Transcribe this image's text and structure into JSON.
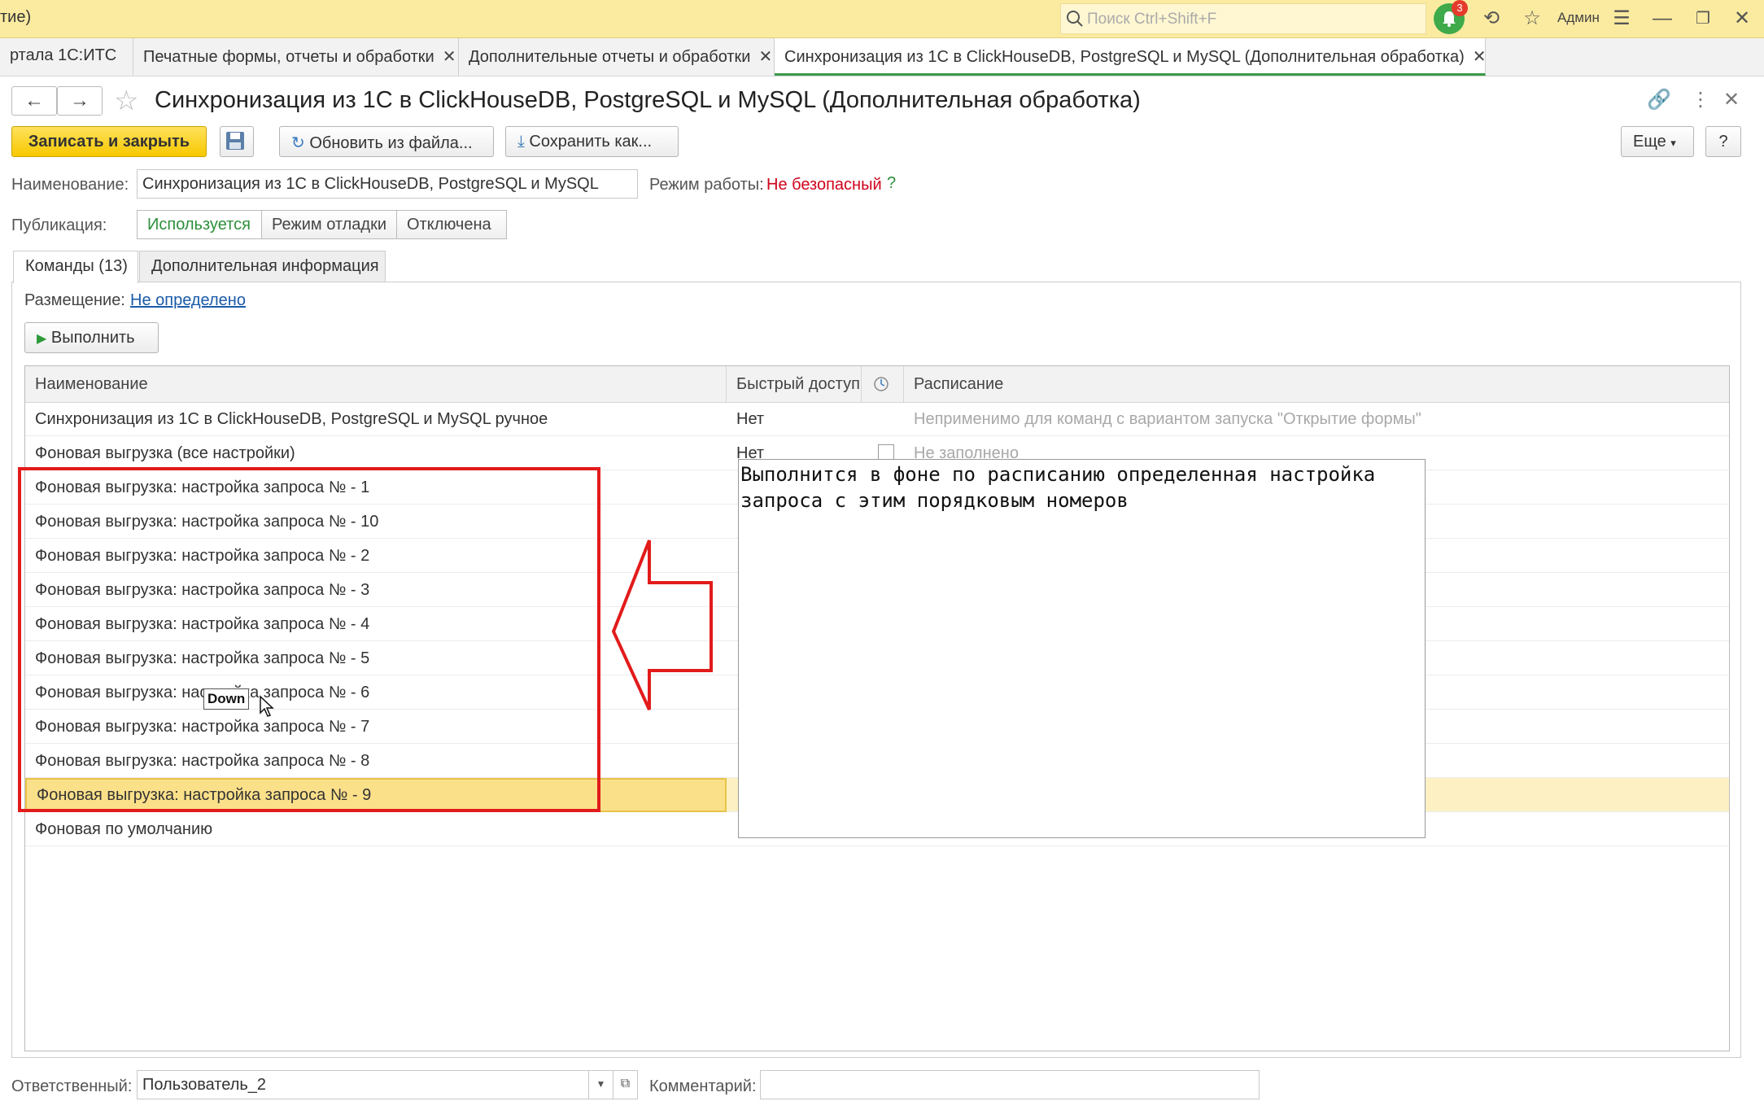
{
  "topbar": {
    "title_fragment": "тие)",
    "search_placeholder": "Поиск Ctrl+Shift+F",
    "notification_count": "3",
    "user": "Админ"
  },
  "tabs": [
    {
      "label": "ртала 1С:ИТС"
    },
    {
      "label": "Печатные формы, отчеты и обработки"
    },
    {
      "label": "Дополнительные отчеты и обработки"
    },
    {
      "label": "Синхронизация из 1С в ClickHouseDB, PostgreSQL и MySQL  (Дополнительная обработка)"
    }
  ],
  "header": {
    "title": "Синхронизация из 1С в ClickHouseDB, PostgreSQL и MySQL  (Дополнительная обработка)"
  },
  "toolbar": {
    "save_close": "Записать и закрыть",
    "update_from_file": "Обновить из файла...",
    "save_as": "Сохранить как...",
    "more": "Еще",
    "help": "?"
  },
  "form": {
    "name_label": "Наименование:",
    "name_value": "Синхронизация из 1С в ClickHouseDB, PostgreSQL и MySQL",
    "mode_label": "Режим работы:",
    "mode_value": "Не безопасный",
    "mode_help": "?",
    "publication_label": "Публикация:",
    "publication_options": [
      "Используется",
      "Режим отладки",
      "Отключена"
    ]
  },
  "content_tabs": [
    "Команды (13)",
    "Дополнительная информация"
  ],
  "placement": {
    "label": "Размещение:",
    "value": "Не определено"
  },
  "run_button": "Выполнить",
  "table": {
    "columns": [
      "Наименование",
      "Быстрый доступ",
      "Расписание"
    ],
    "rows": [
      {
        "name": "Синхронизация из 1С в ClickHouseDB, PostgreSQL и MySQL  ручное",
        "quick": "Нет",
        "schedule": "Неприменимо для команд с вариантом запуска \"Открытие формы\""
      },
      {
        "name": "Фоновая выгрузка (все настройки)",
        "quick": "Нет",
        "schedule": "Не заполнено"
      },
      {
        "name": "Фоновая выгрузка: настройка запроса № - 1",
        "quick": "",
        "schedule": ""
      },
      {
        "name": "Фоновая выгрузка: настройка запроса № - 10",
        "quick": "",
        "schedule": ""
      },
      {
        "name": "Фоновая выгрузка: настройка запроса № - 2",
        "quick": "",
        "schedule": ""
      },
      {
        "name": "Фоновая выгрузка: настройка запроса № - 3",
        "quick": "",
        "schedule": ""
      },
      {
        "name": "Фоновая выгрузка: настройка запроса № - 4",
        "quick": "",
        "schedule": ""
      },
      {
        "name": "Фоновая выгрузка: настройка запроса № - 5",
        "quick": "",
        "schedule": ""
      },
      {
        "name": "Фоновая выгрузка: настройка запроса № - 6",
        "quick": "",
        "schedule": ""
      },
      {
        "name": "Фоновая выгрузка: настройка запроса № - 7",
        "quick": "",
        "schedule": ""
      },
      {
        "name": "Фоновая выгрузка: настройка запроса № - 8",
        "quick": "",
        "schedule": ""
      },
      {
        "name": "Фоновая выгрузка: настройка запроса № - 9",
        "quick": "",
        "schedule": ""
      },
      {
        "name": "Фоновая по умолчанию",
        "quick": "",
        "schedule": ""
      }
    ]
  },
  "annotation": {
    "text": "Выполнится в фоне по расписанию определенная настройка запроса с этим порядковым номеров",
    "down_tip": "Down"
  },
  "footer": {
    "responsible_label": "Ответственный:",
    "responsible_value": "Пользователь_2",
    "comment_label": "Комментарий:",
    "comment_value": ""
  },
  "colors": {
    "accent_yellow": "#f7c800",
    "unsafe_red": "#d0021b",
    "link_blue": "#1a5ba8",
    "annotation_red": "#e21b1b"
  }
}
